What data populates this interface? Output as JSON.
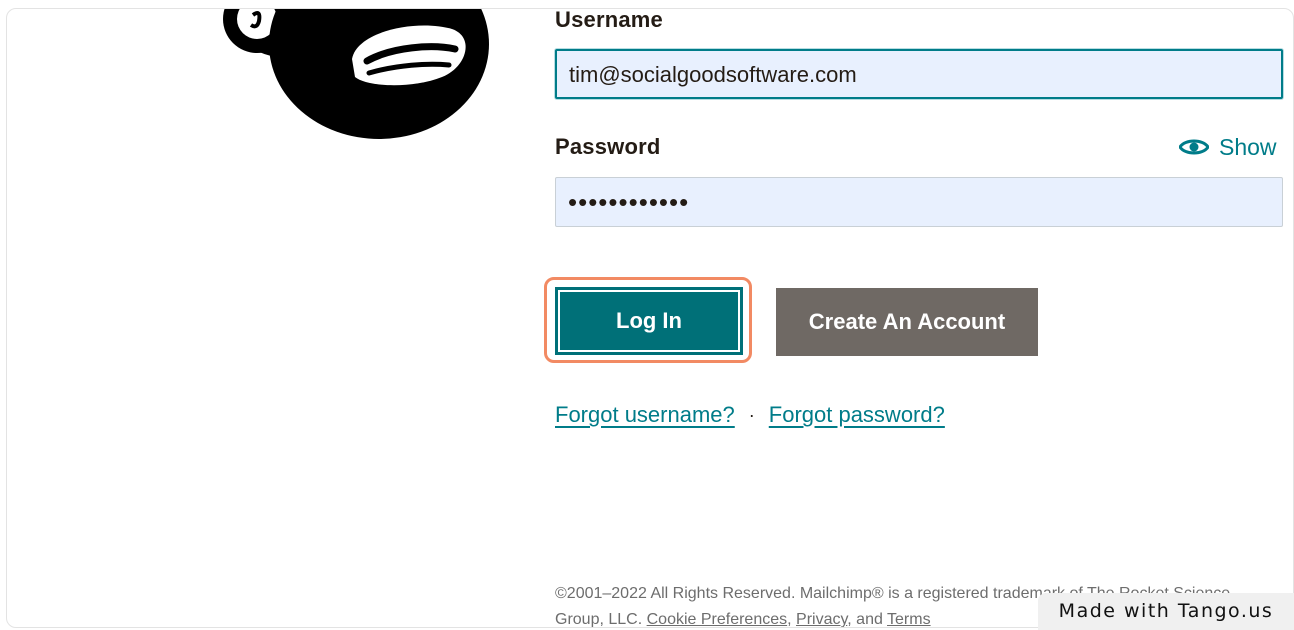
{
  "form": {
    "username_label": "Username",
    "username_value": "tim@socialgoodsoftware.com",
    "password_label": "Password",
    "password_value": "••••••••••••",
    "show_label": "Show",
    "show_icon": "eye-icon"
  },
  "buttons": {
    "login_label": "Log In",
    "create_label": "Create An Account"
  },
  "links": {
    "forgot_username": "Forgot username?",
    "separator": "·",
    "forgot_password": "Forgot password?"
  },
  "footer": {
    "text_part1": "©2001–2022 All Rights Reserved. Mailchimp® is a registered trademark of The Rocket Science Group, LLC.",
    "cookie_preferences": "Cookie Preferences",
    "privacy": "Privacy",
    "and": "and",
    "terms": "Terms"
  },
  "watermark": {
    "text": "Made with Tango.us"
  },
  "colors": {
    "accent": "#007c89",
    "login_button": "#007078",
    "create_button": "#6f6964",
    "focus_ring": "#f28a63",
    "input_fill": "#e8f0fe"
  }
}
